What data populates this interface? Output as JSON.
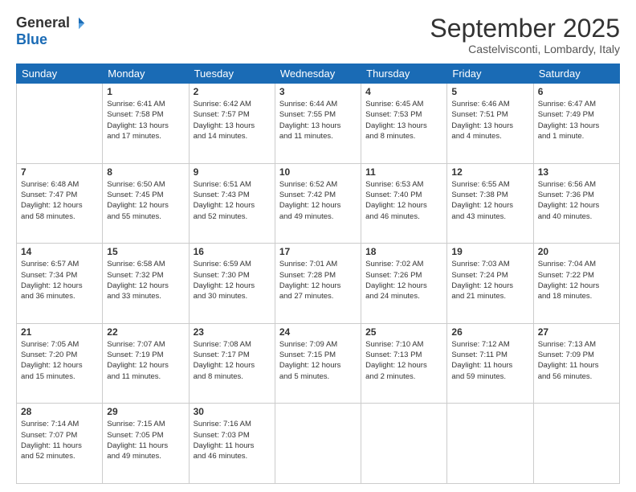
{
  "header": {
    "logo": {
      "general": "General",
      "blue": "Blue"
    },
    "title": "September 2025",
    "location": "Castelvisconti, Lombardy, Italy"
  },
  "weekdays": [
    "Sunday",
    "Monday",
    "Tuesday",
    "Wednesday",
    "Thursday",
    "Friday",
    "Saturday"
  ],
  "weeks": [
    [
      {
        "day": "",
        "info": ""
      },
      {
        "day": "1",
        "info": "Sunrise: 6:41 AM\nSunset: 7:58 PM\nDaylight: 13 hours\nand 17 minutes."
      },
      {
        "day": "2",
        "info": "Sunrise: 6:42 AM\nSunset: 7:57 PM\nDaylight: 13 hours\nand 14 minutes."
      },
      {
        "day": "3",
        "info": "Sunrise: 6:44 AM\nSunset: 7:55 PM\nDaylight: 13 hours\nand 11 minutes."
      },
      {
        "day": "4",
        "info": "Sunrise: 6:45 AM\nSunset: 7:53 PM\nDaylight: 13 hours\nand 8 minutes."
      },
      {
        "day": "5",
        "info": "Sunrise: 6:46 AM\nSunset: 7:51 PM\nDaylight: 13 hours\nand 4 minutes."
      },
      {
        "day": "6",
        "info": "Sunrise: 6:47 AM\nSunset: 7:49 PM\nDaylight: 13 hours\nand 1 minute."
      }
    ],
    [
      {
        "day": "7",
        "info": "Sunrise: 6:48 AM\nSunset: 7:47 PM\nDaylight: 12 hours\nand 58 minutes."
      },
      {
        "day": "8",
        "info": "Sunrise: 6:50 AM\nSunset: 7:45 PM\nDaylight: 12 hours\nand 55 minutes."
      },
      {
        "day": "9",
        "info": "Sunrise: 6:51 AM\nSunset: 7:43 PM\nDaylight: 12 hours\nand 52 minutes."
      },
      {
        "day": "10",
        "info": "Sunrise: 6:52 AM\nSunset: 7:42 PM\nDaylight: 12 hours\nand 49 minutes."
      },
      {
        "day": "11",
        "info": "Sunrise: 6:53 AM\nSunset: 7:40 PM\nDaylight: 12 hours\nand 46 minutes."
      },
      {
        "day": "12",
        "info": "Sunrise: 6:55 AM\nSunset: 7:38 PM\nDaylight: 12 hours\nand 43 minutes."
      },
      {
        "day": "13",
        "info": "Sunrise: 6:56 AM\nSunset: 7:36 PM\nDaylight: 12 hours\nand 40 minutes."
      }
    ],
    [
      {
        "day": "14",
        "info": "Sunrise: 6:57 AM\nSunset: 7:34 PM\nDaylight: 12 hours\nand 36 minutes."
      },
      {
        "day": "15",
        "info": "Sunrise: 6:58 AM\nSunset: 7:32 PM\nDaylight: 12 hours\nand 33 minutes."
      },
      {
        "day": "16",
        "info": "Sunrise: 6:59 AM\nSunset: 7:30 PM\nDaylight: 12 hours\nand 30 minutes."
      },
      {
        "day": "17",
        "info": "Sunrise: 7:01 AM\nSunset: 7:28 PM\nDaylight: 12 hours\nand 27 minutes."
      },
      {
        "day": "18",
        "info": "Sunrise: 7:02 AM\nSunset: 7:26 PM\nDaylight: 12 hours\nand 24 minutes."
      },
      {
        "day": "19",
        "info": "Sunrise: 7:03 AM\nSunset: 7:24 PM\nDaylight: 12 hours\nand 21 minutes."
      },
      {
        "day": "20",
        "info": "Sunrise: 7:04 AM\nSunset: 7:22 PM\nDaylight: 12 hours\nand 18 minutes."
      }
    ],
    [
      {
        "day": "21",
        "info": "Sunrise: 7:05 AM\nSunset: 7:20 PM\nDaylight: 12 hours\nand 15 minutes."
      },
      {
        "day": "22",
        "info": "Sunrise: 7:07 AM\nSunset: 7:19 PM\nDaylight: 12 hours\nand 11 minutes."
      },
      {
        "day": "23",
        "info": "Sunrise: 7:08 AM\nSunset: 7:17 PM\nDaylight: 12 hours\nand 8 minutes."
      },
      {
        "day": "24",
        "info": "Sunrise: 7:09 AM\nSunset: 7:15 PM\nDaylight: 12 hours\nand 5 minutes."
      },
      {
        "day": "25",
        "info": "Sunrise: 7:10 AM\nSunset: 7:13 PM\nDaylight: 12 hours\nand 2 minutes."
      },
      {
        "day": "26",
        "info": "Sunrise: 7:12 AM\nSunset: 7:11 PM\nDaylight: 11 hours\nand 59 minutes."
      },
      {
        "day": "27",
        "info": "Sunrise: 7:13 AM\nSunset: 7:09 PM\nDaylight: 11 hours\nand 56 minutes."
      }
    ],
    [
      {
        "day": "28",
        "info": "Sunrise: 7:14 AM\nSunset: 7:07 PM\nDaylight: 11 hours\nand 52 minutes."
      },
      {
        "day": "29",
        "info": "Sunrise: 7:15 AM\nSunset: 7:05 PM\nDaylight: 11 hours\nand 49 minutes."
      },
      {
        "day": "30",
        "info": "Sunrise: 7:16 AM\nSunset: 7:03 PM\nDaylight: 11 hours\nand 46 minutes."
      },
      {
        "day": "",
        "info": ""
      },
      {
        "day": "",
        "info": ""
      },
      {
        "day": "",
        "info": ""
      },
      {
        "day": "",
        "info": ""
      }
    ]
  ]
}
